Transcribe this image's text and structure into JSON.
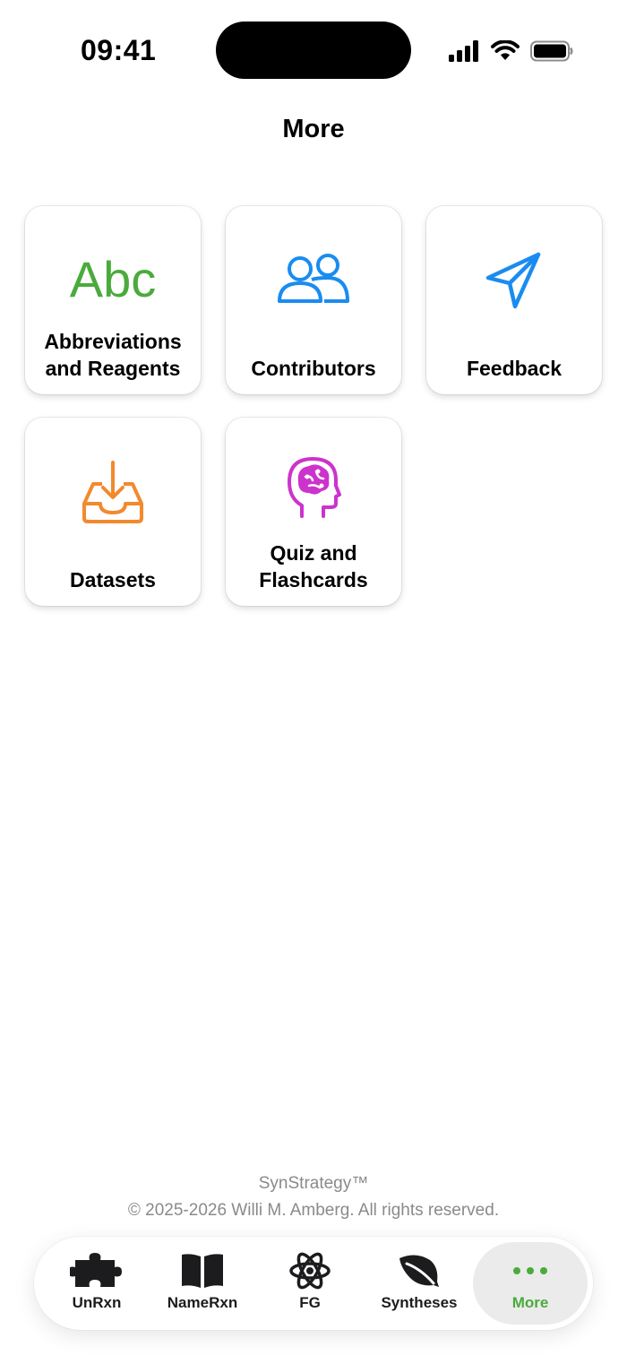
{
  "status_bar": {
    "time": "09:41"
  },
  "header": {
    "title": "More"
  },
  "tiles": [
    {
      "label": "Abbreviations\nand Reagents",
      "icon": "abc-icon",
      "icon_text": "Abc",
      "color": "#4aab3c"
    },
    {
      "label": "Contributors",
      "icon": "people-icon",
      "color": "#1a8cf0"
    },
    {
      "label": "Feedback",
      "icon": "paper-plane-icon",
      "color": "#1a8cf0"
    },
    {
      "label": "Datasets",
      "icon": "tray-download-icon",
      "color": "#f28a2e"
    },
    {
      "label": "Quiz and\nFlashcards",
      "icon": "brain-head-icon",
      "color": "#cc33cc"
    }
  ],
  "footer": {
    "app_name": "SynStrategy™",
    "copyright": "© 2025-2026 Willi M. Amberg. All rights reserved."
  },
  "tabbar": {
    "tabs": [
      {
        "label": "UnRxn",
        "icon": "puzzle-icon"
      },
      {
        "label": "NameRxn",
        "icon": "book-icon"
      },
      {
        "label": "FG",
        "icon": "atom-icon"
      },
      {
        "label": "Syntheses",
        "icon": "leaf-icon"
      },
      {
        "label": "More",
        "icon": "ellipsis-icon",
        "active": true
      }
    ],
    "active_color": "#4aab3c"
  }
}
